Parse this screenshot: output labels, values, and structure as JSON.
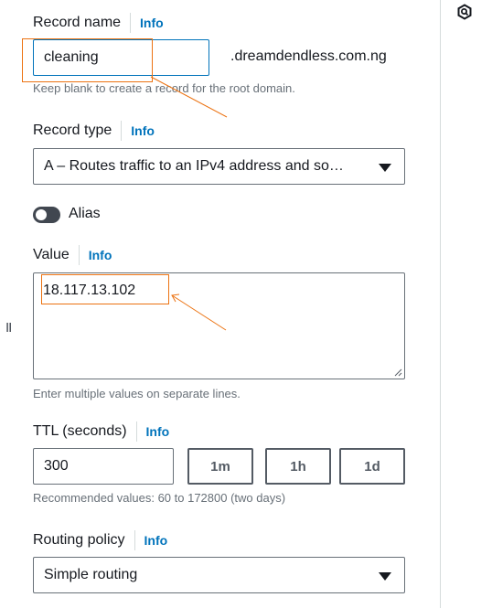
{
  "record_name": {
    "label": "Record name",
    "info": "Info",
    "value": "cleaning",
    "domain_suffix": ".dreamdendless.com.ng",
    "hint": "Keep blank to create a record for the root domain."
  },
  "record_type": {
    "label": "Record type",
    "info": "Info",
    "selected": "A – Routes traffic to an IPv4 address and so…"
  },
  "alias": {
    "label": "Alias",
    "enabled": false
  },
  "value_field": {
    "label": "Value",
    "info": "Info",
    "value": "18.117.13.102",
    "hint": "Enter multiple values on separate lines."
  },
  "ttl": {
    "label": "TTL (seconds)",
    "info": "Info",
    "value": "300",
    "presets": [
      "1m",
      "1h",
      "1d"
    ],
    "hint": "Recommended values: 60 to 172800 (two days)"
  },
  "routing_policy": {
    "label": "Routing policy",
    "info": "Info",
    "selected": "Simple routing"
  },
  "drag_handle": "II",
  "colors": {
    "accent": "#0073bb",
    "annotation": "#ec7211",
    "border": "#687078"
  }
}
